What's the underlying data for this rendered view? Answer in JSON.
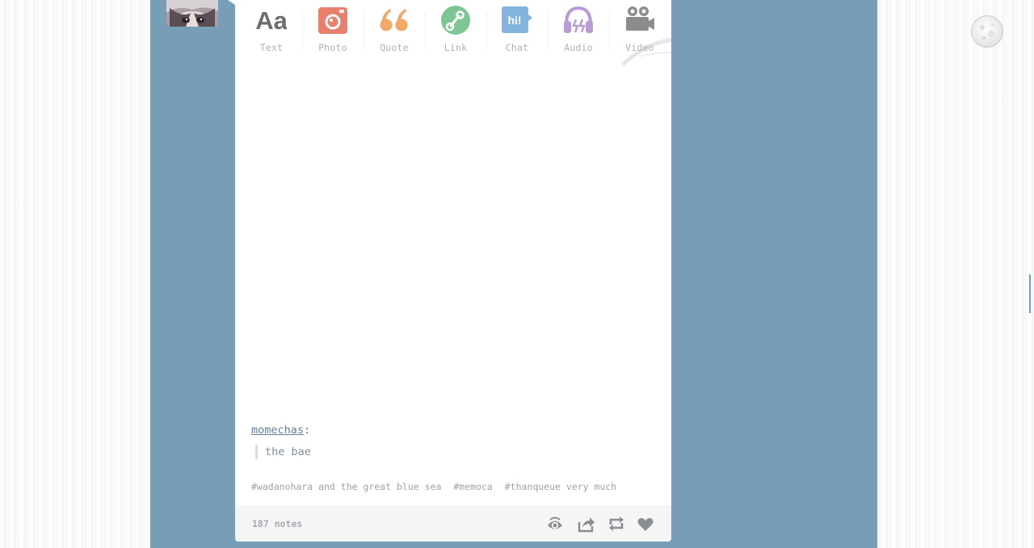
{
  "post_types": [
    {
      "key": "text",
      "label": "Text",
      "icon": "text-icon",
      "color": "#6e6e6e"
    },
    {
      "key": "photo",
      "label": "Photo",
      "icon": "camera-icon",
      "color": "#e8806c"
    },
    {
      "key": "quote",
      "label": "Quote",
      "icon": "quote-icon",
      "color": "#f3a867"
    },
    {
      "key": "link",
      "label": "Link",
      "icon": "link-icon",
      "color": "#7cc794"
    },
    {
      "key": "chat",
      "label": "Chat",
      "icon": "chat-icon",
      "color": "#83b4de"
    },
    {
      "key": "audio",
      "label": "Audio",
      "icon": "headphones-icon",
      "color": "#b99cd6"
    },
    {
      "key": "video",
      "label": "Video",
      "icon": "video-camera-icon",
      "color": "#8c8c8c"
    }
  ],
  "icons": {
    "text_glyph": "Aa",
    "chat_glyph": "hi!"
  },
  "post": {
    "source_user": "momechas",
    "source_separator": ":",
    "quote": "the bae",
    "tags": [
      "#wadanohara and the great blue sea",
      "#memoca",
      "#thanqueue very much"
    ]
  },
  "footer": {
    "notes": "187 notes",
    "actions": [
      "eye-icon",
      "share-icon",
      "reblog-icon",
      "heart-icon"
    ]
  },
  "colors": {
    "background_blue": "#789db7",
    "card": "#ffffff",
    "footer_bg": "#f5f5f5",
    "link_blue": "#5d7fa0"
  }
}
